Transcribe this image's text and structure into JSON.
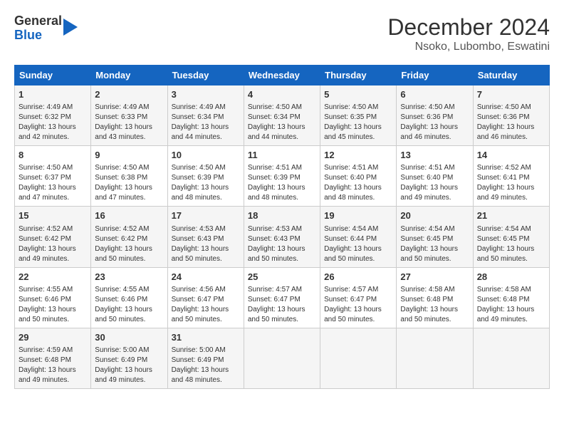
{
  "header": {
    "logo_line1": "General",
    "logo_line2": "Blue",
    "title": "December 2024",
    "subtitle": "Nsoko, Lubombo, Eswatini"
  },
  "days_of_week": [
    "Sunday",
    "Monday",
    "Tuesday",
    "Wednesday",
    "Thursday",
    "Friday",
    "Saturday"
  ],
  "weeks": [
    [
      {
        "num": "1",
        "sunrise": "4:49 AM",
        "sunset": "6:32 PM",
        "daylight": "13 hours and 42 minutes."
      },
      {
        "num": "2",
        "sunrise": "4:49 AM",
        "sunset": "6:33 PM",
        "daylight": "13 hours and 43 minutes."
      },
      {
        "num": "3",
        "sunrise": "4:49 AM",
        "sunset": "6:34 PM",
        "daylight": "13 hours and 44 minutes."
      },
      {
        "num": "4",
        "sunrise": "4:50 AM",
        "sunset": "6:34 PM",
        "daylight": "13 hours and 44 minutes."
      },
      {
        "num": "5",
        "sunrise": "4:50 AM",
        "sunset": "6:35 PM",
        "daylight": "13 hours and 45 minutes."
      },
      {
        "num": "6",
        "sunrise": "4:50 AM",
        "sunset": "6:36 PM",
        "daylight": "13 hours and 46 minutes."
      },
      {
        "num": "7",
        "sunrise": "4:50 AM",
        "sunset": "6:36 PM",
        "daylight": "13 hours and 46 minutes."
      }
    ],
    [
      {
        "num": "8",
        "sunrise": "4:50 AM",
        "sunset": "6:37 PM",
        "daylight": "13 hours and 47 minutes."
      },
      {
        "num": "9",
        "sunrise": "4:50 AM",
        "sunset": "6:38 PM",
        "daylight": "13 hours and 47 minutes."
      },
      {
        "num": "10",
        "sunrise": "4:50 AM",
        "sunset": "6:39 PM",
        "daylight": "13 hours and 48 minutes."
      },
      {
        "num": "11",
        "sunrise": "4:51 AM",
        "sunset": "6:39 PM",
        "daylight": "13 hours and 48 minutes."
      },
      {
        "num": "12",
        "sunrise": "4:51 AM",
        "sunset": "6:40 PM",
        "daylight": "13 hours and 48 minutes."
      },
      {
        "num": "13",
        "sunrise": "4:51 AM",
        "sunset": "6:40 PM",
        "daylight": "13 hours and 49 minutes."
      },
      {
        "num": "14",
        "sunrise": "4:52 AM",
        "sunset": "6:41 PM",
        "daylight": "13 hours and 49 minutes."
      }
    ],
    [
      {
        "num": "15",
        "sunrise": "4:52 AM",
        "sunset": "6:42 PM",
        "daylight": "13 hours and 49 minutes."
      },
      {
        "num": "16",
        "sunrise": "4:52 AM",
        "sunset": "6:42 PM",
        "daylight": "13 hours and 50 minutes."
      },
      {
        "num": "17",
        "sunrise": "4:53 AM",
        "sunset": "6:43 PM",
        "daylight": "13 hours and 50 minutes."
      },
      {
        "num": "18",
        "sunrise": "4:53 AM",
        "sunset": "6:43 PM",
        "daylight": "13 hours and 50 minutes."
      },
      {
        "num": "19",
        "sunrise": "4:54 AM",
        "sunset": "6:44 PM",
        "daylight": "13 hours and 50 minutes."
      },
      {
        "num": "20",
        "sunrise": "4:54 AM",
        "sunset": "6:45 PM",
        "daylight": "13 hours and 50 minutes."
      },
      {
        "num": "21",
        "sunrise": "4:54 AM",
        "sunset": "6:45 PM",
        "daylight": "13 hours and 50 minutes."
      }
    ],
    [
      {
        "num": "22",
        "sunrise": "4:55 AM",
        "sunset": "6:46 PM",
        "daylight": "13 hours and 50 minutes."
      },
      {
        "num": "23",
        "sunrise": "4:55 AM",
        "sunset": "6:46 PM",
        "daylight": "13 hours and 50 minutes."
      },
      {
        "num": "24",
        "sunrise": "4:56 AM",
        "sunset": "6:47 PM",
        "daylight": "13 hours and 50 minutes."
      },
      {
        "num": "25",
        "sunrise": "4:57 AM",
        "sunset": "6:47 PM",
        "daylight": "13 hours and 50 minutes."
      },
      {
        "num": "26",
        "sunrise": "4:57 AM",
        "sunset": "6:47 PM",
        "daylight": "13 hours and 50 minutes."
      },
      {
        "num": "27",
        "sunrise": "4:58 AM",
        "sunset": "6:48 PM",
        "daylight": "13 hours and 50 minutes."
      },
      {
        "num": "28",
        "sunrise": "4:58 AM",
        "sunset": "6:48 PM",
        "daylight": "13 hours and 49 minutes."
      }
    ],
    [
      {
        "num": "29",
        "sunrise": "4:59 AM",
        "sunset": "6:48 PM",
        "daylight": "13 hours and 49 minutes."
      },
      {
        "num": "30",
        "sunrise": "5:00 AM",
        "sunset": "6:49 PM",
        "daylight": "13 hours and 49 minutes."
      },
      {
        "num": "31",
        "sunrise": "5:00 AM",
        "sunset": "6:49 PM",
        "daylight": "13 hours and 48 minutes."
      },
      null,
      null,
      null,
      null
    ]
  ]
}
